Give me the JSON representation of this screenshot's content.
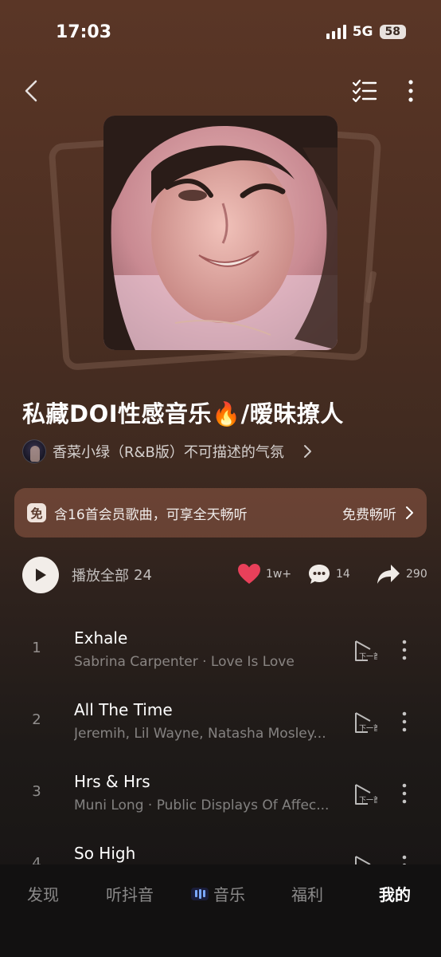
{
  "status": {
    "time": "17:03",
    "network": "5G",
    "battery": "58"
  },
  "playlist": {
    "title": "私藏DOI性感音乐🔥/暧昧撩人",
    "creator": "香菜小绿（R&B版）不可描述的气氛"
  },
  "vip_banner": {
    "badge": "免",
    "text": "含16首会员歌曲，可享全天畅听",
    "action": "免费畅听"
  },
  "actions": {
    "play_all_label": "播放全部",
    "play_all_count": "24",
    "likes": "1w+",
    "comments": "14",
    "shares": "290"
  },
  "songs": [
    {
      "num": "1",
      "title": "Exhale",
      "meta": "Sabrina Carpenter · Love Is Love"
    },
    {
      "num": "2",
      "title": "All The Time",
      "meta": "Jeremih, Lil Wayne, Natasha Mosley..."
    },
    {
      "num": "3",
      "title": "Hrs & Hrs",
      "meta": "Muni Long · Public Displays Of Affec..."
    },
    {
      "num": "4",
      "title": "So High",
      "meta": ""
    }
  ],
  "tabs": [
    {
      "label": "发现"
    },
    {
      "label": "听抖音"
    },
    {
      "label": "音乐"
    },
    {
      "label": "福利"
    },
    {
      "label": "我的"
    }
  ],
  "colors": {
    "like": "#e8405a",
    "background_top": "#5a3626",
    "background_bottom": "#151313"
  },
  "icons": [
    "back-icon",
    "playlist-manage-icon",
    "more-icon",
    "play-icon",
    "heart-icon",
    "comment-icon",
    "share-icon",
    "play-next-icon"
  ]
}
